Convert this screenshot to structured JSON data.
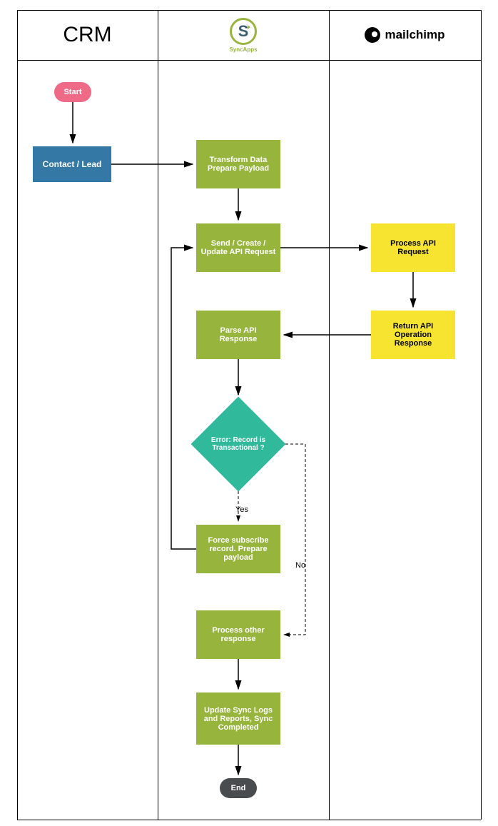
{
  "columns": {
    "crm": "CRM",
    "syncapps_label": "SyncApps",
    "mailchimp": "mailchimp"
  },
  "nodes": {
    "start": "Start",
    "contact_lead": "Contact / Lead",
    "transform": "Transform Data Prepare Payload",
    "send_req": "Send / Create / Update API Request",
    "process_api": "Process API Request",
    "return_api": "Return API Operation Response",
    "parse_resp": "Parse API Response",
    "decision": "Error: Record is Transactional ?",
    "force_sub": "Force subscribe record. Prepare payload",
    "process_other": "Process other response",
    "update_logs": "Update Sync Logs and Reports, Sync Completed",
    "end": "End"
  },
  "labels": {
    "yes": "Yes",
    "no": "No"
  },
  "flow_edges": [
    {
      "from": "start",
      "to": "contact_lead"
    },
    {
      "from": "contact_lead",
      "to": "transform"
    },
    {
      "from": "transform",
      "to": "send_req"
    },
    {
      "from": "send_req",
      "to": "process_api"
    },
    {
      "from": "process_api",
      "to": "return_api"
    },
    {
      "from": "return_api",
      "to": "parse_resp"
    },
    {
      "from": "parse_resp",
      "to": "decision"
    },
    {
      "from": "decision",
      "to": "force_sub",
      "label": "Yes"
    },
    {
      "from": "decision",
      "to": "process_other",
      "label": "No"
    },
    {
      "from": "force_sub",
      "to": "send_req"
    },
    {
      "from": "process_other",
      "to": "update_logs"
    },
    {
      "from": "update_logs",
      "to": "end"
    }
  ]
}
